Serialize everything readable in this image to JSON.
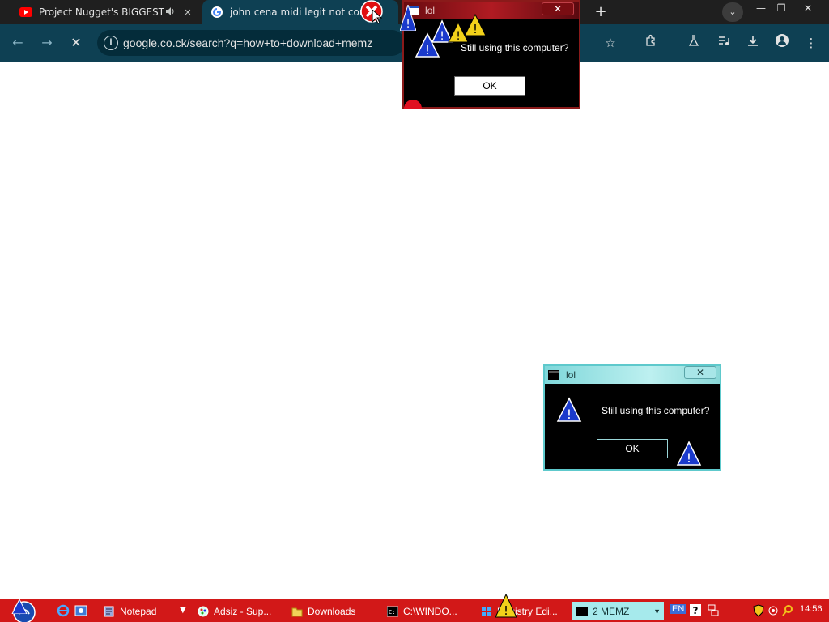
{
  "browser": {
    "tabs": [
      {
        "title": "Project Nugget's BIGGEST U",
        "favicon": "youtube-icon",
        "extra_icon": "speaker-icon",
        "close": "✕"
      },
      {
        "title": "john cena midi legit not conve",
        "favicon": "google-icon"
      }
    ],
    "new_tab": "+",
    "tab_search": "⌄",
    "window_controls": {
      "minimize": "—",
      "restore": "❐",
      "close": "✕"
    },
    "address": "google.co.ck/search?q=how+to+download+memz",
    "nav": {
      "back": "←",
      "forward": "→",
      "stop": "✕"
    }
  },
  "dialogs": [
    {
      "title": "lol",
      "message": "Still using this computer?",
      "ok": "OK",
      "close": "✕"
    },
    {
      "title": "lol",
      "message": "Still using this computer?",
      "ok": "OK",
      "close": "✕"
    }
  ],
  "taskbar": {
    "items": [
      {
        "label": "Notepad",
        "icon": "notepad-icon"
      },
      {
        "label": "Adsiz - Sup...",
        "icon": "paint-icon"
      },
      {
        "label": "Downloads",
        "icon": "folder-icon"
      },
      {
        "label": "C:\\WINDO...",
        "icon": "cmd-icon"
      },
      {
        "label": "Registry Edi...",
        "icon": "regedit-icon"
      },
      {
        "label": "2 MEMZ",
        "icon": "console-icon"
      }
    ],
    "language": "EN",
    "clock": "14:56"
  },
  "colors": {
    "taskbar": "#d21818",
    "toolbar": "#0e4053",
    "active_task": "#a6eaec"
  }
}
